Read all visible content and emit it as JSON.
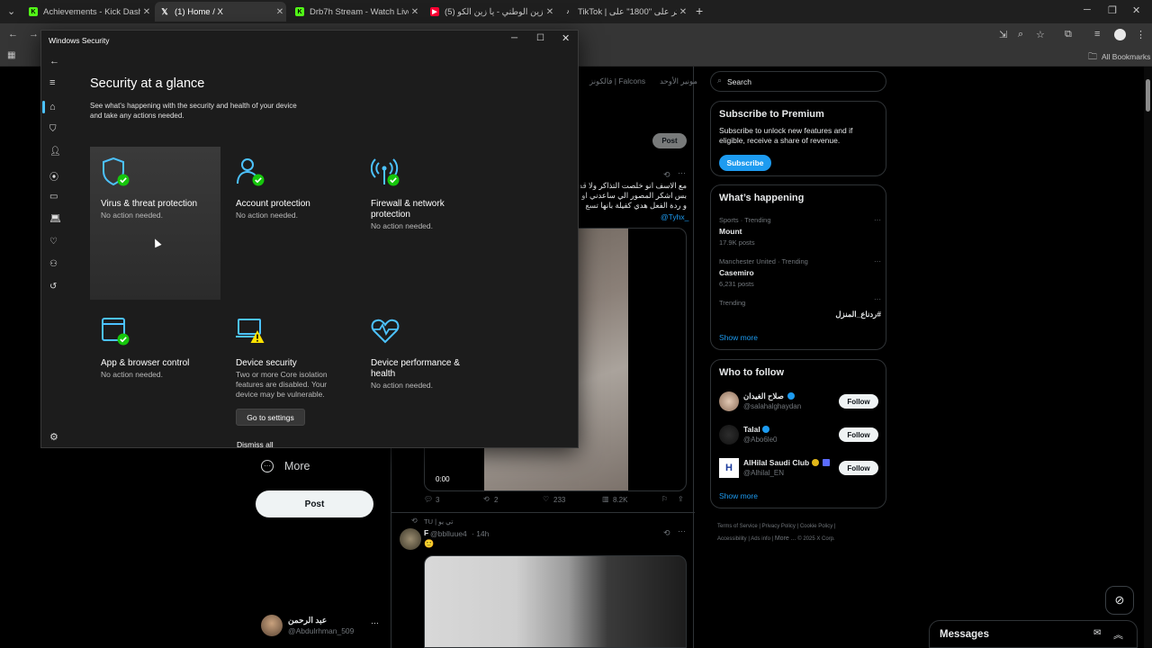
{
  "browser": {
    "tabs": [
      {
        "label": "Achievements - Kick Dashboard",
        "fav_color": "#53fc18"
      },
      {
        "label": "(1) Home / X",
        "fav_color": "#ffffff"
      },
      {
        "label": "Drb7h Stream - Watch Live on K",
        "fav_color": "#53fc18"
      },
      {
        "label": "(5) عمل زين الوطني - يا زين الكو",
        "fav_color": "#ff0033"
      },
      {
        "label": "TikTok | اعثر على \"1800\" على ...",
        "fav_color": "#ffffff"
      }
    ],
    "new_tab": "+",
    "bookmarks_label": "All Bookmarks"
  },
  "x": {
    "tabs_bar": [
      "فالكونز | Falcons",
      "مونير الأوحد"
    ],
    "post_button": "Post",
    "tweet1": {
      "lines": [
        "مع الاسف انو خلصت التذاكر ولا قد",
        "بس اشكر المصور الي ساعدني او",
        "و ردة الفعل هدي كفيلة بانها تسع"
      ],
      "mention": "@Tyhx_",
      "video_time": "0:00",
      "replies": "3",
      "reposts": "2",
      "likes": "233",
      "views": "8.2K"
    },
    "tweet2": {
      "reposted_by": "TU | تي يو",
      "author": "F",
      "handle": "@bblluue4",
      "time": "· 14h",
      "emoji": "🙂"
    },
    "left_nav": {
      "more": "More",
      "post": "Post",
      "account_name": "عبد الرحمن",
      "account_handle": "@Abdulrhman_509",
      "account_more": "···"
    },
    "search_placeholder": "Search",
    "premium": {
      "title": "Subscribe to Premium",
      "text": "Subscribe to unlock new features and if eligible, receive a share of revenue.",
      "button": "Subscribe"
    },
    "happening": {
      "title": "What’s happening",
      "items": [
        {
          "meta": "Sports · Trending",
          "topic": "Mount",
          "count": "17.9K posts"
        },
        {
          "meta": "Manchester United · Trending",
          "topic": "Casemiro",
          "count": "6,231 posts"
        },
        {
          "meta": "Trending",
          "topic": "#ردناع_المنزل",
          "count": ""
        }
      ],
      "show_more": "Show more"
    },
    "who_to_follow": {
      "title": "Who to follow",
      "people": [
        {
          "name": "صلاح الغيدان",
          "handle": "@salahalghaydan",
          "button": "Follow"
        },
        {
          "name": "Talal",
          "handle": "@Abo6le0",
          "button": "Follow"
        },
        {
          "name": "AlHilal Saudi Club",
          "handle": "@Alhilal_EN",
          "button": "Follow"
        }
      ],
      "show_more": "Show more"
    },
    "footer": [
      "Terms of Service",
      "Privacy Policy",
      "Cookie Policy",
      "Accessibility",
      "Ads info",
      "More ...",
      "© 2025 X Corp."
    ],
    "messages": "Messages"
  },
  "winsec": {
    "window_title": "Windows Security",
    "heading": "Security at a glance",
    "description": "See what's happening with the security and health of your device and take any actions needed.",
    "tiles": [
      {
        "title": "Virus & threat protection",
        "status": "No action needed."
      },
      {
        "title": "Account protection",
        "status": "No action needed."
      },
      {
        "title": "Firewall & network protection",
        "status": "No action needed."
      },
      {
        "title": "App & browser control",
        "status": "No action needed."
      },
      {
        "title": "Device security",
        "status": "Two or more Core isolation features are disabled.  Your device may be vulnerable."
      },
      {
        "title": "Device performance & health",
        "status": "No action needed."
      }
    ],
    "go_to_settings": "Go to settings",
    "dismiss_all": "Dismiss all",
    "colors": {
      "accent": "#4cc2ff",
      "ok": "#16c60c",
      "warn": "#fce100"
    }
  }
}
